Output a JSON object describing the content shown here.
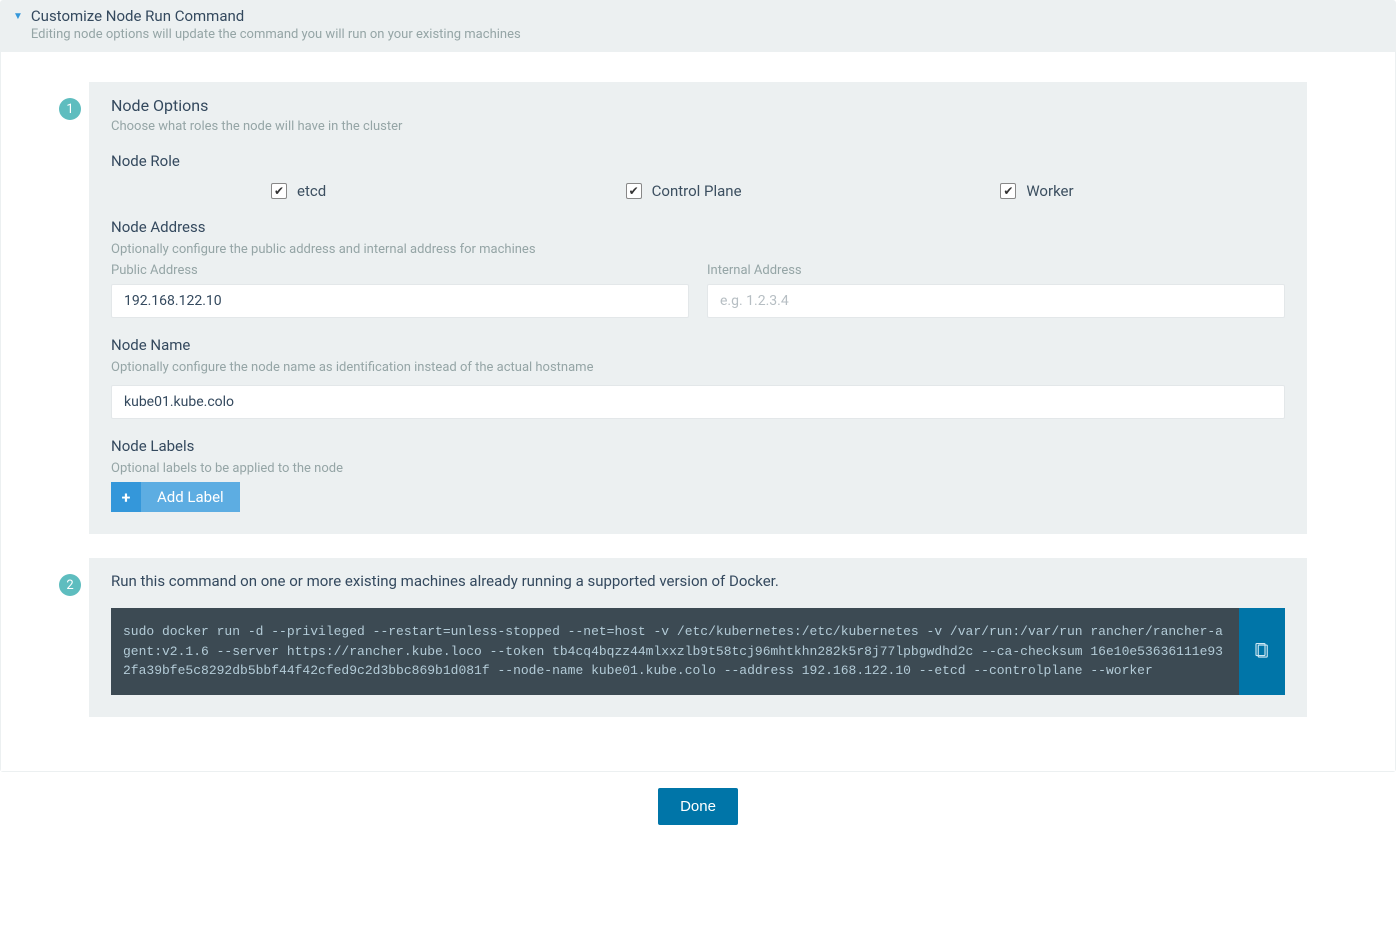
{
  "header": {
    "title": "Customize Node Run Command",
    "subtitle": "Editing node options will update the command you will run on your existing machines"
  },
  "step1": {
    "badge": "1",
    "title": "Node Options",
    "subtitle": "Choose what roles the node will have in the cluster",
    "node_role_label": "Node Role",
    "roles": {
      "etcd": "etcd",
      "control_plane": "Control Plane",
      "worker": "Worker"
    },
    "node_address": {
      "title": "Node Address",
      "subtitle": "Optionally configure the public address and internal address for machines",
      "public_label": "Public Address",
      "public_value": "192.168.122.10",
      "internal_label": "Internal Address",
      "internal_placeholder": "e.g. 1.2.3.4",
      "internal_value": ""
    },
    "node_name": {
      "title": "Node Name",
      "subtitle": "Optionally configure the node name as identification instead of the actual hostname",
      "value": "kube01.kube.colo"
    },
    "node_labels": {
      "title": "Node Labels",
      "subtitle": "Optional labels to be applied to the node",
      "add_button": "Add Label"
    }
  },
  "step2": {
    "badge": "2",
    "title": "Run this command on one or more existing machines already running a supported version of Docker.",
    "command": "sudo docker run -d --privileged --restart=unless-stopped --net=host -v /etc/kubernetes:/etc/kubernetes -v /var/run:/var/run rancher/rancher-agent:v2.1.6 --server https://rancher.kube.loco --token tb4cq4bqzz44mlxxzlb9t58tcj96mhtkhn282k5r8j77lpbgwdhd2c --ca-checksum 16e10e53636111e932fa39bfe5c8292db5bbf44f42cfed9c2d3bbc869b1d081f --node-name kube01.kube.colo --address 192.168.122.10 --etcd --controlplane --worker"
  },
  "footer": {
    "done": "Done"
  }
}
